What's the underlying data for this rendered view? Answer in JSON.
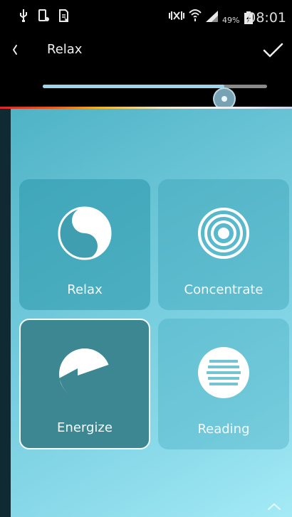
{
  "status_bar": {
    "battery_percent": "49%",
    "time": "08:01"
  },
  "title_bar": {
    "title": "Relax"
  },
  "slider": {
    "value": 0.81
  },
  "tiles": [
    {
      "label": "Relax",
      "icon": "yin-yang-icon"
    },
    {
      "label": "Concentrate",
      "icon": "concentric-circles-icon"
    },
    {
      "label": "Energize",
      "icon": "lightning-icon",
      "selected": true
    },
    {
      "label": "Reading",
      "icon": "reading-lines-icon"
    }
  ],
  "colors": {
    "accent": "#9fd5ea",
    "selected_border": "#f4fbfc"
  }
}
